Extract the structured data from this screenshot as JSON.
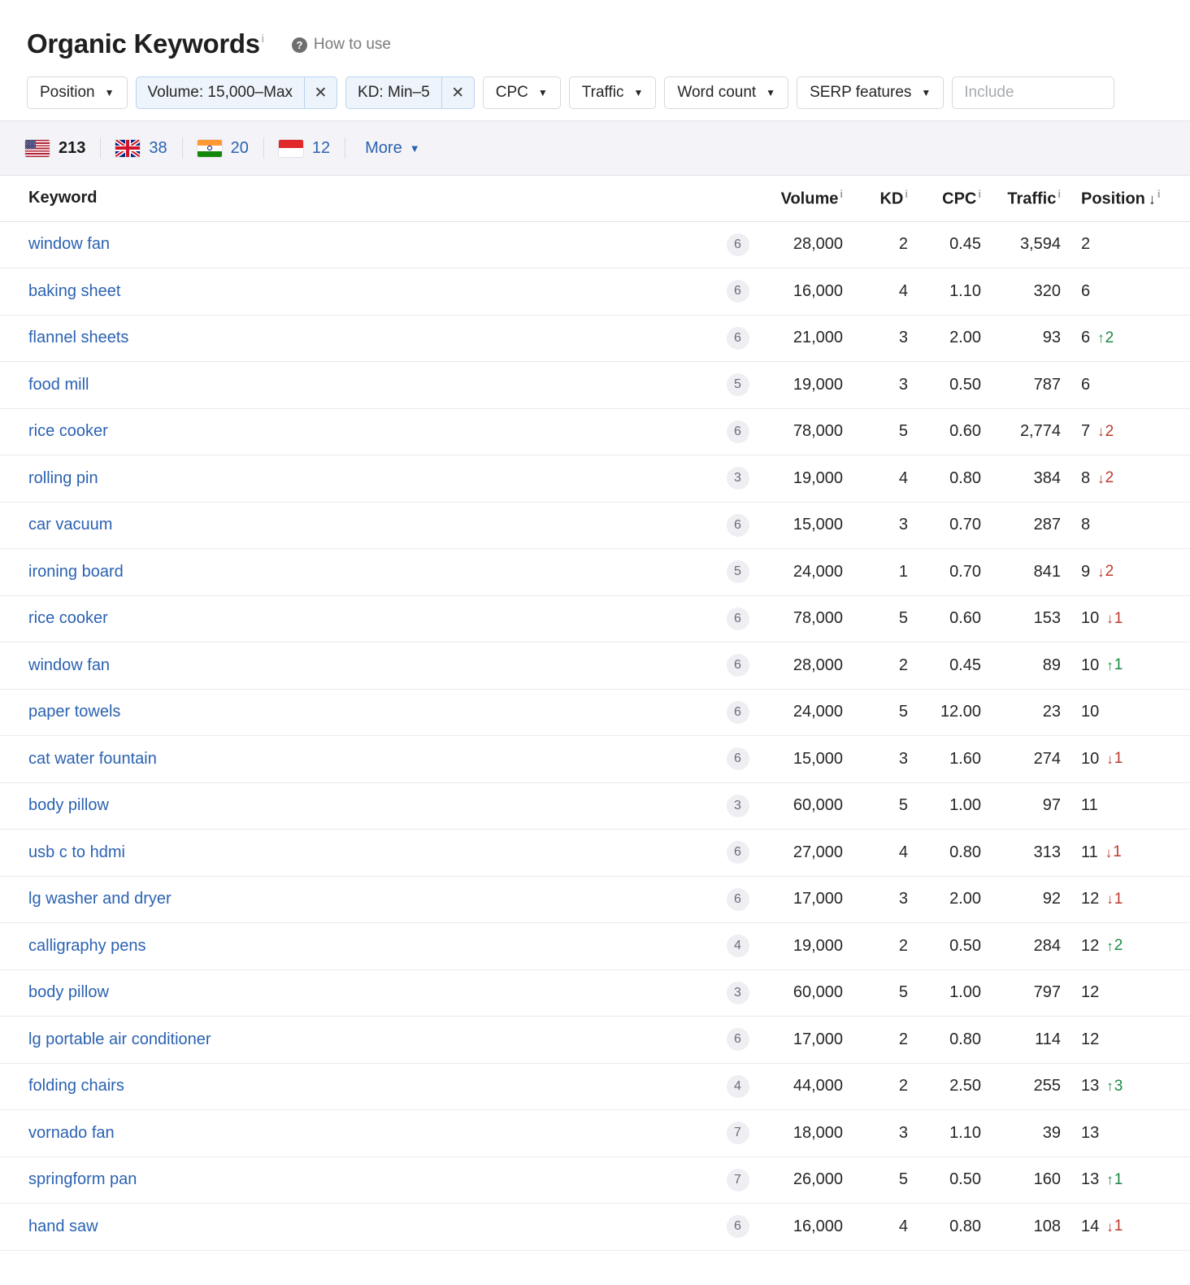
{
  "header": {
    "title": "Organic Keywords",
    "title_sup": "i",
    "how_to_use": "How to use",
    "help_icon": "?"
  },
  "filters": {
    "position": {
      "label": "Position",
      "caret": "▼"
    },
    "volume_chip": {
      "label": "Volume: 15,000–Max",
      "close": "✕"
    },
    "kd_chip": {
      "label": "KD: Min–5",
      "close": "✕"
    },
    "cpc": {
      "label": "CPC",
      "caret": "▼"
    },
    "traffic": {
      "label": "Traffic",
      "caret": "▼"
    },
    "word_count": {
      "label": "Word count",
      "caret": "▼"
    },
    "serp_features": {
      "label": "SERP features",
      "caret": "▼"
    },
    "include": {
      "value": "",
      "placeholder": "Include"
    }
  },
  "countries": {
    "items": [
      {
        "name": "united-states",
        "count": "213",
        "active": true
      },
      {
        "name": "united-kingdom",
        "count": "38",
        "active": false
      },
      {
        "name": "india",
        "count": "20",
        "active": false
      },
      {
        "name": "indonesia",
        "count": "12",
        "active": false
      }
    ],
    "more_label": "More",
    "more_caret": "▼"
  },
  "table": {
    "columns": {
      "keyword": "Keyword",
      "volume": "Volume",
      "kd": "KD",
      "cpc": "CPC",
      "traffic": "Traffic",
      "position": "Position",
      "info_sup": "i",
      "sort_arrow": "↓"
    },
    "rows": [
      {
        "keyword": "window fan",
        "serp": "6",
        "volume": "28,000",
        "kd": "2",
        "cpc": "0.45",
        "traffic": "3,594",
        "position": "2",
        "change": "",
        "dir": ""
      },
      {
        "keyword": "baking sheet",
        "serp": "6",
        "volume": "16,000",
        "kd": "4",
        "cpc": "1.10",
        "traffic": "320",
        "position": "6",
        "change": "",
        "dir": ""
      },
      {
        "keyword": "flannel sheets",
        "serp": "6",
        "volume": "21,000",
        "kd": "3",
        "cpc": "2.00",
        "traffic": "93",
        "position": "6",
        "change": "2",
        "dir": "up"
      },
      {
        "keyword": "food mill",
        "serp": "5",
        "volume": "19,000",
        "kd": "3",
        "cpc": "0.50",
        "traffic": "787",
        "position": "6",
        "change": "",
        "dir": ""
      },
      {
        "keyword": "rice cooker",
        "serp": "6",
        "volume": "78,000",
        "kd": "5",
        "cpc": "0.60",
        "traffic": "2,774",
        "position": "7",
        "change": "2",
        "dir": "down"
      },
      {
        "keyword": "rolling pin",
        "serp": "3",
        "volume": "19,000",
        "kd": "4",
        "cpc": "0.80",
        "traffic": "384",
        "position": "8",
        "change": "2",
        "dir": "down"
      },
      {
        "keyword": "car vacuum",
        "serp": "6",
        "volume": "15,000",
        "kd": "3",
        "cpc": "0.70",
        "traffic": "287",
        "position": "8",
        "change": "",
        "dir": ""
      },
      {
        "keyword": "ironing board",
        "serp": "5",
        "volume": "24,000",
        "kd": "1",
        "cpc": "0.70",
        "traffic": "841",
        "position": "9",
        "change": "2",
        "dir": "down"
      },
      {
        "keyword": "rice cooker",
        "serp": "6",
        "volume": "78,000",
        "kd": "5",
        "cpc": "0.60",
        "traffic": "153",
        "position": "10",
        "change": "1",
        "dir": "down"
      },
      {
        "keyword": "window fan",
        "serp": "6",
        "volume": "28,000",
        "kd": "2",
        "cpc": "0.45",
        "traffic": "89",
        "position": "10",
        "change": "1",
        "dir": "up"
      },
      {
        "keyword": "paper towels",
        "serp": "6",
        "volume": "24,000",
        "kd": "5",
        "cpc": "12.00",
        "traffic": "23",
        "position": "10",
        "change": "",
        "dir": ""
      },
      {
        "keyword": "cat water fountain",
        "serp": "6",
        "volume": "15,000",
        "kd": "3",
        "cpc": "1.60",
        "traffic": "274",
        "position": "10",
        "change": "1",
        "dir": "down"
      },
      {
        "keyword": "body pillow",
        "serp": "3",
        "volume": "60,000",
        "kd": "5",
        "cpc": "1.00",
        "traffic": "97",
        "position": "11",
        "change": "",
        "dir": ""
      },
      {
        "keyword": "usb c to hdmi",
        "serp": "6",
        "volume": "27,000",
        "kd": "4",
        "cpc": "0.80",
        "traffic": "313",
        "position": "11",
        "change": "1",
        "dir": "down"
      },
      {
        "keyword": "lg washer and dryer",
        "serp": "6",
        "volume": "17,000",
        "kd": "3",
        "cpc": "2.00",
        "traffic": "92",
        "position": "12",
        "change": "1",
        "dir": "down"
      },
      {
        "keyword": "calligraphy pens",
        "serp": "4",
        "volume": "19,000",
        "kd": "2",
        "cpc": "0.50",
        "traffic": "284",
        "position": "12",
        "change": "2",
        "dir": "up"
      },
      {
        "keyword": "body pillow",
        "serp": "3",
        "volume": "60,000",
        "kd": "5",
        "cpc": "1.00",
        "traffic": "797",
        "position": "12",
        "change": "",
        "dir": ""
      },
      {
        "keyword": "lg portable air conditioner",
        "serp": "6",
        "volume": "17,000",
        "kd": "2",
        "cpc": "0.80",
        "traffic": "114",
        "position": "12",
        "change": "",
        "dir": ""
      },
      {
        "keyword": "folding chairs",
        "serp": "4",
        "volume": "44,000",
        "kd": "2",
        "cpc": "2.50",
        "traffic": "255",
        "position": "13",
        "change": "3",
        "dir": "up"
      },
      {
        "keyword": "vornado fan",
        "serp": "7",
        "volume": "18,000",
        "kd": "3",
        "cpc": "1.10",
        "traffic": "39",
        "position": "13",
        "change": "",
        "dir": ""
      },
      {
        "keyword": "springform pan",
        "serp": "7",
        "volume": "26,000",
        "kd": "5",
        "cpc": "0.50",
        "traffic": "160",
        "position": "13",
        "change": "1",
        "dir": "up"
      },
      {
        "keyword": "hand saw",
        "serp": "6",
        "volume": "16,000",
        "kd": "4",
        "cpc": "0.80",
        "traffic": "108",
        "position": "14",
        "change": "1",
        "dir": "down"
      }
    ]
  },
  "colors": {
    "link": "#2b62b1",
    "up": "#188a42",
    "down": "#c0392b",
    "chip_bg": "#eef4fb",
    "chip_border": "#b9d3ef",
    "country_bar_bg": "#f4f4f8"
  }
}
